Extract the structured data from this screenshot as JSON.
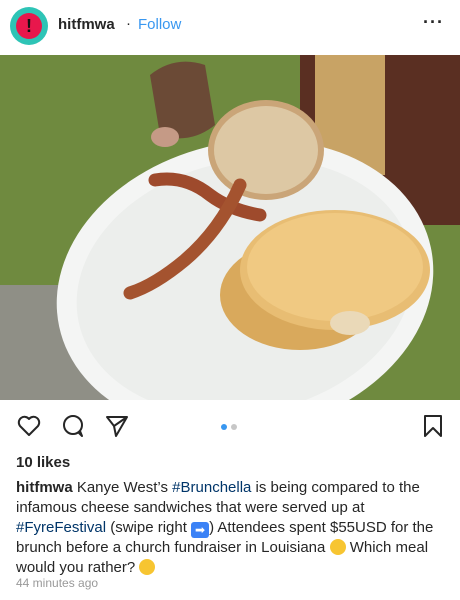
{
  "post": {
    "username": "hitfmwa",
    "separator": "·",
    "follow_label": "Follow",
    "more_icon": "more-horizontal-icon",
    "likes": "10 likes",
    "time": "44 minutes ago",
    "carousel": {
      "count": 2,
      "active": 0
    },
    "caption": {
      "username": "hitfmwa",
      "t1": " Kanye West’s ",
      "tag1": "#Brunchella",
      "t2": " is being compared to the infamous cheese sandwiches that were served up at ",
      "tag2": "#FyreFestival",
      "t3": " (swipe right ",
      "t4": ") Attendees spent $55USD for the brunch before a church fundraiser in Louisiana ",
      "t5": " Which meal would you rather? "
    }
  },
  "icons": {
    "like": "heart-icon",
    "comment": "comment-icon",
    "share": "send-icon",
    "save": "bookmark-icon"
  },
  "colors": {
    "follow": "#3897f0",
    "hashtag": "#003569",
    "avatar_ring": "#2ec4b6",
    "avatar_fill": "#e8174c",
    "dot_active": "#3897f0",
    "dot_inactive": "#c7c7c7"
  }
}
